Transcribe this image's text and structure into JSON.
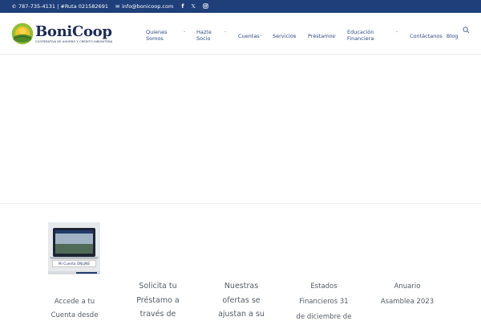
{
  "topbar": {
    "phone": "787-735-4131 | #Ruta 021582691",
    "email": "info@bonicoop.com",
    "social": [
      "facebook-icon",
      "x-icon",
      "instagram-icon"
    ]
  },
  "logo": {
    "brand": "BoniCoop",
    "tagline": "COOPERATIVA DE AHORRO Y CRÉDITO AIBONITEÑA"
  },
  "nav": {
    "items": [
      {
        "line1": "Quienes",
        "line2": "Somos",
        "has_dropdown": true
      },
      {
        "line1": "Hazte",
        "line2": "Socio",
        "has_dropdown": true
      },
      {
        "line1": "Cuentas",
        "line2": "",
        "has_dropdown": true
      },
      {
        "line1": "Servicios",
        "line2": "",
        "has_dropdown": true
      },
      {
        "line1": "Préstamos",
        "line2": "",
        "has_dropdown": true
      },
      {
        "line1": "Educación",
        "line2": "Financiera",
        "has_dropdown": true
      },
      {
        "line1": "Contáctanos",
        "line2": "",
        "has_dropdown": false
      },
      {
        "line1": "Blog",
        "line2": "",
        "has_dropdown": false
      }
    ]
  },
  "thumbnail": {
    "button_label": "Mi Cuenta ONLINE"
  },
  "columns": [
    {
      "lines": [
        "Accede a tu",
        "Cuenta desde"
      ]
    },
    {
      "lines": [
        "Solicita tu",
        "Préstamo a",
        "través de"
      ]
    },
    {
      "lines": [
        "Nuestras",
        "ofertas se",
        "ajustan a su"
      ]
    },
    {
      "lines": [
        "Estados",
        "Financieros 31",
        "de diciembre de"
      ]
    },
    {
      "lines": [
        "Anuario",
        "Asamblea 2023"
      ]
    }
  ],
  "colors": {
    "topbar_bg": "#1f3f7a",
    "brand_navy": "#1d2b56",
    "nav_text": "#2e4a85",
    "body_text": "#555c66"
  }
}
